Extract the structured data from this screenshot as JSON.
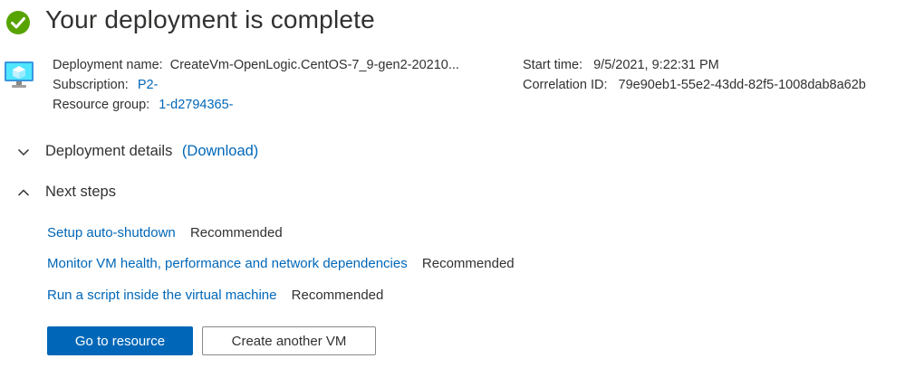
{
  "header": {
    "title": "Your deployment is complete"
  },
  "deployment": {
    "name_label": "Deployment name:",
    "name_value": "CreateVm-OpenLogic.CentOS-7_9-gen2-20210...",
    "subscription_label": "Subscription:",
    "subscription_value": "P2-",
    "resource_group_label": "Resource group:",
    "resource_group_value": "1-d2794365-",
    "start_time_label": "Start time:",
    "start_time_value": "9/5/2021, 9:22:31 PM",
    "correlation_label": "Correlation ID:",
    "correlation_value": "79e90eb1-55e2-43dd-82f5-1008dab8a62b"
  },
  "details": {
    "label": "Deployment details",
    "download_link": "(Download)"
  },
  "next_steps": {
    "label": "Next steps",
    "items": [
      {
        "link": "Setup auto-shutdown",
        "tag": "Recommended"
      },
      {
        "link": "Monitor VM health, performance and network dependencies",
        "tag": "Recommended"
      },
      {
        "link": "Run a script inside the virtual machine",
        "tag": "Recommended"
      }
    ]
  },
  "actions": {
    "primary": "Go to resource",
    "secondary": "Create another VM"
  },
  "colors": {
    "success": "#57a300",
    "link": "#0067b8",
    "primary_button": "#0067b8"
  },
  "icons": {
    "status": "checkmark-circle-icon",
    "resource": "virtual-machine-icon",
    "details_toggle": "chevron-down-icon",
    "next_steps_toggle": "chevron-up-icon"
  }
}
